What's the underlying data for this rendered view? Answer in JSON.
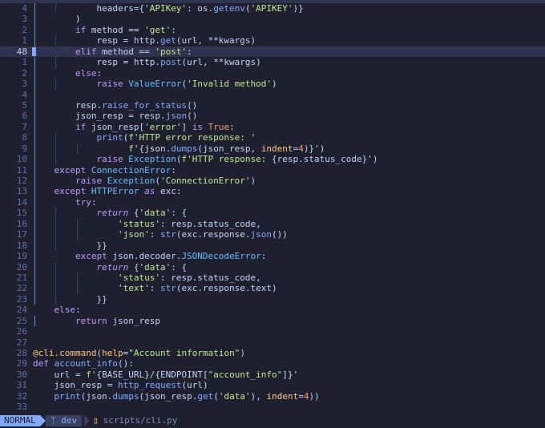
{
  "status": {
    "mode": "NORMAL",
    "branch": "dev",
    "branch_icon": "git-branch-icon",
    "file_icon": "file-icon",
    "file": "scripts/cli.py"
  },
  "editor": {
    "current_line": 48,
    "lines": [
      {
        "n": "4",
        "g": [
          1,
          2
        ],
        "t": [
          [
            "pl",
            "            headers={"
          ],
          [
            "str",
            "'APIKey'"
          ],
          [
            "pl",
            ": os."
          ],
          [
            "fn",
            "getenv"
          ],
          [
            "pl",
            "("
          ],
          [
            "str",
            "'APIKEY'"
          ],
          [
            "pl",
            ")}"
          ]
        ]
      },
      {
        "n": "3",
        "g": [
          1
        ],
        "t": [
          [
            "pl",
            "        )"
          ]
        ]
      },
      {
        "n": "2",
        "g": [
          1
        ],
        "t": [
          [
            "kw",
            "        if"
          ],
          [
            "pl",
            " method == "
          ],
          [
            "str",
            "'get'"
          ],
          [
            "pl",
            ":"
          ]
        ]
      },
      {
        "n": "1",
        "g": [
          1,
          2
        ],
        "t": [
          [
            "pl",
            "            resp = http."
          ],
          [
            "fn",
            "get"
          ],
          [
            "pl",
            "(url, **kwargs)"
          ]
        ]
      },
      {
        "n": "48",
        "cur": true,
        "g": [],
        "t": [
          [
            "kw",
            "        elif"
          ],
          [
            "pl",
            " method == "
          ],
          [
            "str",
            "'post'"
          ],
          [
            "pl",
            ":"
          ]
        ]
      },
      {
        "n": "1",
        "g": [
          1,
          2
        ],
        "t": [
          [
            "pl",
            "            resp = http."
          ],
          [
            "fn",
            "post"
          ],
          [
            "pl",
            "(url, **kwargs)"
          ]
        ]
      },
      {
        "n": "2",
        "g": [
          1
        ],
        "t": [
          [
            "kw",
            "        else"
          ],
          [
            "pl",
            ":"
          ]
        ]
      },
      {
        "n": "3",
        "g": [
          1,
          2
        ],
        "t": [
          [
            "kw",
            "            raise "
          ],
          [
            "cls",
            "ValueError"
          ],
          [
            "pl",
            "("
          ],
          [
            "str",
            "'Invalid method'"
          ],
          [
            "pl",
            ")"
          ]
        ]
      },
      {
        "n": "4",
        "g": [
          1
        ],
        "t": []
      },
      {
        "n": "5",
        "g": [
          1
        ],
        "t": [
          [
            "pl",
            "        resp."
          ],
          [
            "fn",
            "raise_for_status"
          ],
          [
            "pl",
            "()"
          ]
        ]
      },
      {
        "n": "6",
        "g": [
          1
        ],
        "t": [
          [
            "pl",
            "        json_resp = resp."
          ],
          [
            "fn",
            "json"
          ],
          [
            "pl",
            "()"
          ]
        ]
      },
      {
        "n": "7",
        "g": [
          1
        ],
        "t": [
          [
            "kw",
            "        if"
          ],
          [
            "pl",
            " json_resp["
          ],
          [
            "str",
            "'error'"
          ],
          [
            "pl",
            "] "
          ],
          [
            "kw",
            "is "
          ],
          [
            "const",
            "True"
          ],
          [
            "pl",
            ":"
          ]
        ]
      },
      {
        "n": "8",
        "g": [
          1,
          2
        ],
        "t": [
          [
            "fn",
            "            print"
          ],
          [
            "pl",
            "("
          ],
          [
            "str",
            "f'HTTP error response: '"
          ]
        ]
      },
      {
        "n": "9",
        "g": [
          1,
          2,
          3
        ],
        "t": [
          [
            "str",
            "                  f'"
          ],
          [
            "pl",
            "{json."
          ],
          [
            "fn",
            "dumps"
          ],
          [
            "pl",
            "(json_resp, "
          ],
          [
            "prm",
            "indent"
          ],
          [
            "pl",
            "="
          ],
          [
            "num",
            "4"
          ],
          [
            "pl",
            ")}"
          ],
          [
            "str",
            "'"
          ],
          [
            "pl",
            ")"
          ]
        ]
      },
      {
        "n": "10",
        "g": [
          1,
          2
        ],
        "t": [
          [
            "kw",
            "            raise "
          ],
          [
            "cls",
            "Exception"
          ],
          [
            "pl",
            "("
          ],
          [
            "str",
            "f'HTTP response: "
          ],
          [
            "pl",
            "{resp.status_code}"
          ],
          [
            "str",
            "'"
          ],
          [
            "pl",
            ")"
          ]
        ]
      },
      {
        "n": "11",
        "g": [
          1
        ],
        "t": [
          [
            "kw",
            "    except "
          ],
          [
            "cls",
            "ConnectionError"
          ],
          [
            "pl",
            ":"
          ]
        ]
      },
      {
        "n": "12",
        "g": [
          1
        ],
        "t": [
          [
            "kw",
            "        raise "
          ],
          [
            "cls",
            "Exception"
          ],
          [
            "pl",
            "("
          ],
          [
            "str",
            "'ConnectionError'"
          ],
          [
            "pl",
            ")"
          ]
        ]
      },
      {
        "n": "13",
        "g": [
          1
        ],
        "t": [
          [
            "kw",
            "    except "
          ],
          [
            "cls",
            "HTTPError "
          ],
          [
            "ital",
            "as"
          ],
          [
            "pl",
            " exc:"
          ]
        ]
      },
      {
        "n": "14",
        "g": [
          1
        ],
        "t": [
          [
            "kw",
            "        try"
          ],
          [
            "pl",
            ":"
          ]
        ]
      },
      {
        "n": "15",
        "g": [
          1,
          2
        ],
        "t": [
          [
            "ital",
            "            return"
          ],
          [
            "pl",
            " {"
          ],
          [
            "str",
            "'data'"
          ],
          [
            "pl",
            ": {"
          ]
        ]
      },
      {
        "n": "16",
        "g": [
          1,
          2,
          3
        ],
        "t": [
          [
            "str",
            "                'status'"
          ],
          [
            "pl",
            ": resp.status_code,"
          ]
        ]
      },
      {
        "n": "17",
        "g": [
          1,
          2,
          3
        ],
        "t": [
          [
            "str",
            "                'json'"
          ],
          [
            "pl",
            ": "
          ],
          [
            "fn",
            "str"
          ],
          [
            "pl",
            "(exc.response."
          ],
          [
            "fn",
            "json"
          ],
          [
            "pl",
            "())"
          ]
        ]
      },
      {
        "n": "18",
        "g": [
          1,
          2
        ],
        "t": [
          [
            "pl",
            "            }}"
          ]
        ]
      },
      {
        "n": "19",
        "g": [
          1
        ],
        "t": [
          [
            "kw",
            "        except"
          ],
          [
            "pl",
            " json.decoder."
          ],
          [
            "cls",
            "JSONDecodeError"
          ],
          [
            "pl",
            ":"
          ]
        ]
      },
      {
        "n": "20",
        "g": [
          1,
          2
        ],
        "t": [
          [
            "ital",
            "            return"
          ],
          [
            "pl",
            " {"
          ],
          [
            "str",
            "'data'"
          ],
          [
            "pl",
            ": {"
          ]
        ]
      },
      {
        "n": "21",
        "g": [
          1,
          2,
          3
        ],
        "t": [
          [
            "str",
            "                'status'"
          ],
          [
            "pl",
            ": resp.status_code,"
          ]
        ]
      },
      {
        "n": "22",
        "g": [
          1,
          2,
          3
        ],
        "t": [
          [
            "str",
            "                'text'"
          ],
          [
            "pl",
            ": "
          ],
          [
            "fn",
            "str"
          ],
          [
            "pl",
            "(exc.response.text)"
          ]
        ]
      },
      {
        "n": "23",
        "g": [
          1,
          2
        ],
        "t": [
          [
            "pl",
            "            }}"
          ]
        ]
      },
      {
        "n": "24",
        "g": [],
        "t": [
          [
            "kw",
            "    else"
          ],
          [
            "pl",
            ":"
          ]
        ]
      },
      {
        "n": "25",
        "g": [
          1
        ],
        "t": [
          [
            "kw",
            "        return"
          ],
          [
            "pl",
            " json_resp"
          ]
        ]
      },
      {
        "n": "26",
        "g": [],
        "t": []
      },
      {
        "n": "27",
        "g": [],
        "t": []
      },
      {
        "n": "28",
        "g": [],
        "t": [
          [
            "dec",
            "@cli.command"
          ],
          [
            "pl",
            "("
          ],
          [
            "prm",
            "help"
          ],
          [
            "pl",
            "="
          ],
          [
            "str",
            "\"Account information\""
          ],
          [
            "pl",
            ")"
          ]
        ]
      },
      {
        "n": "29",
        "g": [],
        "t": [
          [
            "kw",
            "def "
          ],
          [
            "fn",
            "account_info"
          ],
          [
            "pl",
            "():"
          ]
        ]
      },
      {
        "n": "30",
        "g": [],
        "t": [
          [
            "pl",
            "    url = "
          ],
          [
            "str",
            "f'"
          ],
          [
            "pl",
            "{BASE_URL}"
          ],
          [
            "str",
            "/"
          ],
          [
            "pl",
            "{ENDPOINT["
          ],
          [
            "str",
            "\"account_info\""
          ],
          [
            "pl",
            "]}"
          ],
          [
            "str",
            "'"
          ]
        ]
      },
      {
        "n": "31",
        "g": [],
        "t": [
          [
            "pl",
            "    json_resp = "
          ],
          [
            "fn",
            "http_request"
          ],
          [
            "pl",
            "(url)"
          ]
        ]
      },
      {
        "n": "32",
        "g": [],
        "t": [
          [
            "fn",
            "    print"
          ],
          [
            "pl",
            "(json."
          ],
          [
            "fn",
            "dumps"
          ],
          [
            "pl",
            "(json_resp."
          ],
          [
            "fn",
            "get"
          ],
          [
            "pl",
            "("
          ],
          [
            "str",
            "'data'"
          ],
          [
            "pl",
            "), "
          ],
          [
            "prm",
            "indent"
          ],
          [
            "pl",
            "="
          ],
          [
            "num",
            "4"
          ],
          [
            "pl",
            "))"
          ]
        ]
      },
      {
        "n": "33",
        "g": [],
        "t": []
      }
    ]
  }
}
